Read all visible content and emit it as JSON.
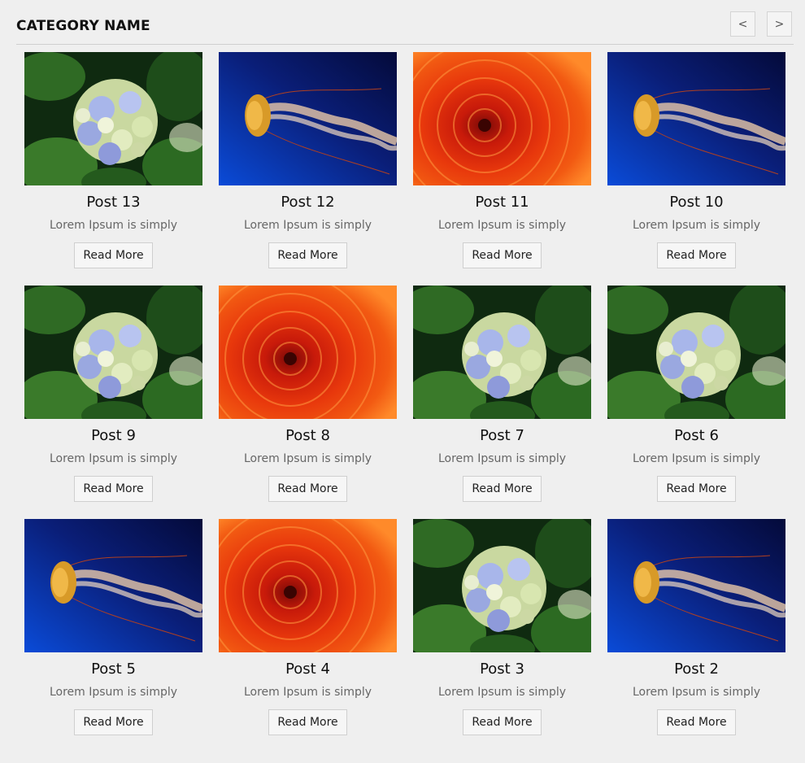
{
  "category": {
    "title": "CATEGORY NAME",
    "prev_label": "<",
    "next_label": ">"
  },
  "posts": [
    {
      "title": "Post 13",
      "excerpt": "Lorem Ipsum is simply",
      "button": "Read More",
      "image": "hydrangea"
    },
    {
      "title": "Post 12",
      "excerpt": "Lorem Ipsum is simply",
      "button": "Read More",
      "image": "jellyfish"
    },
    {
      "title": "Post 11",
      "excerpt": "Lorem Ipsum is simply",
      "button": "Read More",
      "image": "chrysanthemum"
    },
    {
      "title": "Post 10",
      "excerpt": "Lorem Ipsum is simply",
      "button": "Read More",
      "image": "jellyfish"
    },
    {
      "title": "Post 9",
      "excerpt": "Lorem Ipsum is simply",
      "button": "Read More",
      "image": "hydrangea"
    },
    {
      "title": "Post 8",
      "excerpt": "Lorem Ipsum is simply",
      "button": "Read More",
      "image": "chrysanthemum"
    },
    {
      "title": "Post 7",
      "excerpt": "Lorem Ipsum is simply",
      "button": "Read More",
      "image": "hydrangea"
    },
    {
      "title": "Post 6",
      "excerpt": "Lorem Ipsum is simply",
      "button": "Read More",
      "image": "hydrangea"
    },
    {
      "title": "Post 5",
      "excerpt": "Lorem Ipsum is simply",
      "button": "Read More",
      "image": "jellyfish"
    },
    {
      "title": "Post 4",
      "excerpt": "Lorem Ipsum is simply",
      "button": "Read More",
      "image": "chrysanthemum"
    },
    {
      "title": "Post 3",
      "excerpt": "Lorem Ipsum is simply",
      "button": "Read More",
      "image": "hydrangea"
    },
    {
      "title": "Post 2",
      "excerpt": "Lorem Ipsum is simply",
      "button": "Read More",
      "image": "jellyfish"
    }
  ]
}
